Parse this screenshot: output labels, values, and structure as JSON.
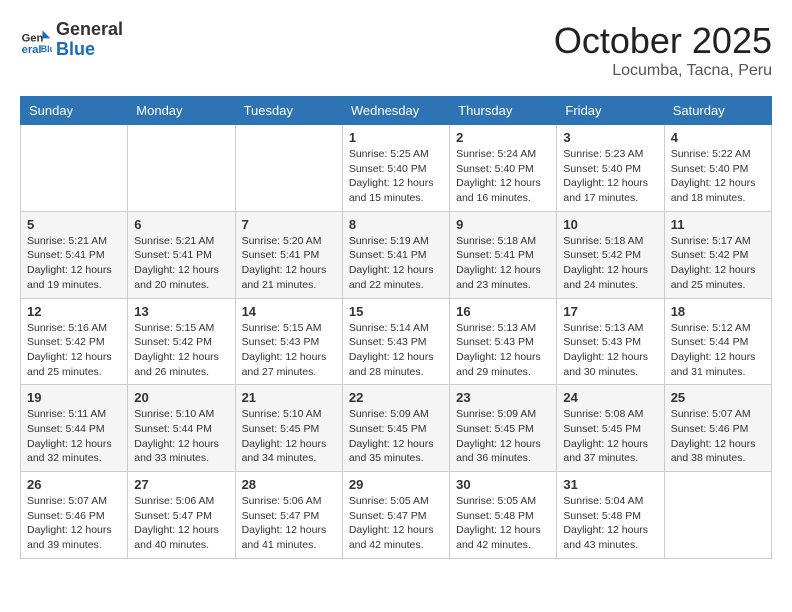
{
  "header": {
    "logo_general": "General",
    "logo_blue": "Blue",
    "month_title": "October 2025",
    "location": "Locumba, Tacna, Peru"
  },
  "days_of_week": [
    "Sunday",
    "Monday",
    "Tuesday",
    "Wednesday",
    "Thursday",
    "Friday",
    "Saturday"
  ],
  "weeks": [
    [
      {
        "day": "",
        "info": ""
      },
      {
        "day": "",
        "info": ""
      },
      {
        "day": "",
        "info": ""
      },
      {
        "day": "1",
        "info": "Sunrise: 5:25 AM\nSunset: 5:40 PM\nDaylight: 12 hours and 15 minutes."
      },
      {
        "day": "2",
        "info": "Sunrise: 5:24 AM\nSunset: 5:40 PM\nDaylight: 12 hours and 16 minutes."
      },
      {
        "day": "3",
        "info": "Sunrise: 5:23 AM\nSunset: 5:40 PM\nDaylight: 12 hours and 17 minutes."
      },
      {
        "day": "4",
        "info": "Sunrise: 5:22 AM\nSunset: 5:40 PM\nDaylight: 12 hours and 18 minutes."
      }
    ],
    [
      {
        "day": "5",
        "info": "Sunrise: 5:21 AM\nSunset: 5:41 PM\nDaylight: 12 hours and 19 minutes."
      },
      {
        "day": "6",
        "info": "Sunrise: 5:21 AM\nSunset: 5:41 PM\nDaylight: 12 hours and 20 minutes."
      },
      {
        "day": "7",
        "info": "Sunrise: 5:20 AM\nSunset: 5:41 PM\nDaylight: 12 hours and 21 minutes."
      },
      {
        "day": "8",
        "info": "Sunrise: 5:19 AM\nSunset: 5:41 PM\nDaylight: 12 hours and 22 minutes."
      },
      {
        "day": "9",
        "info": "Sunrise: 5:18 AM\nSunset: 5:41 PM\nDaylight: 12 hours and 23 minutes."
      },
      {
        "day": "10",
        "info": "Sunrise: 5:18 AM\nSunset: 5:42 PM\nDaylight: 12 hours and 24 minutes."
      },
      {
        "day": "11",
        "info": "Sunrise: 5:17 AM\nSunset: 5:42 PM\nDaylight: 12 hours and 25 minutes."
      }
    ],
    [
      {
        "day": "12",
        "info": "Sunrise: 5:16 AM\nSunset: 5:42 PM\nDaylight: 12 hours and 25 minutes."
      },
      {
        "day": "13",
        "info": "Sunrise: 5:15 AM\nSunset: 5:42 PM\nDaylight: 12 hours and 26 minutes."
      },
      {
        "day": "14",
        "info": "Sunrise: 5:15 AM\nSunset: 5:43 PM\nDaylight: 12 hours and 27 minutes."
      },
      {
        "day": "15",
        "info": "Sunrise: 5:14 AM\nSunset: 5:43 PM\nDaylight: 12 hours and 28 minutes."
      },
      {
        "day": "16",
        "info": "Sunrise: 5:13 AM\nSunset: 5:43 PM\nDaylight: 12 hours and 29 minutes."
      },
      {
        "day": "17",
        "info": "Sunrise: 5:13 AM\nSunset: 5:43 PM\nDaylight: 12 hours and 30 minutes."
      },
      {
        "day": "18",
        "info": "Sunrise: 5:12 AM\nSunset: 5:44 PM\nDaylight: 12 hours and 31 minutes."
      }
    ],
    [
      {
        "day": "19",
        "info": "Sunrise: 5:11 AM\nSunset: 5:44 PM\nDaylight: 12 hours and 32 minutes."
      },
      {
        "day": "20",
        "info": "Sunrise: 5:10 AM\nSunset: 5:44 PM\nDaylight: 12 hours and 33 minutes."
      },
      {
        "day": "21",
        "info": "Sunrise: 5:10 AM\nSunset: 5:45 PM\nDaylight: 12 hours and 34 minutes."
      },
      {
        "day": "22",
        "info": "Sunrise: 5:09 AM\nSunset: 5:45 PM\nDaylight: 12 hours and 35 minutes."
      },
      {
        "day": "23",
        "info": "Sunrise: 5:09 AM\nSunset: 5:45 PM\nDaylight: 12 hours and 36 minutes."
      },
      {
        "day": "24",
        "info": "Sunrise: 5:08 AM\nSunset: 5:45 PM\nDaylight: 12 hours and 37 minutes."
      },
      {
        "day": "25",
        "info": "Sunrise: 5:07 AM\nSunset: 5:46 PM\nDaylight: 12 hours and 38 minutes."
      }
    ],
    [
      {
        "day": "26",
        "info": "Sunrise: 5:07 AM\nSunset: 5:46 PM\nDaylight: 12 hours and 39 minutes."
      },
      {
        "day": "27",
        "info": "Sunrise: 5:06 AM\nSunset: 5:47 PM\nDaylight: 12 hours and 40 minutes."
      },
      {
        "day": "28",
        "info": "Sunrise: 5:06 AM\nSunset: 5:47 PM\nDaylight: 12 hours and 41 minutes."
      },
      {
        "day": "29",
        "info": "Sunrise: 5:05 AM\nSunset: 5:47 PM\nDaylight: 12 hours and 42 minutes."
      },
      {
        "day": "30",
        "info": "Sunrise: 5:05 AM\nSunset: 5:48 PM\nDaylight: 12 hours and 42 minutes."
      },
      {
        "day": "31",
        "info": "Sunrise: 5:04 AM\nSunset: 5:48 PM\nDaylight: 12 hours and 43 minutes."
      },
      {
        "day": "",
        "info": ""
      }
    ]
  ]
}
